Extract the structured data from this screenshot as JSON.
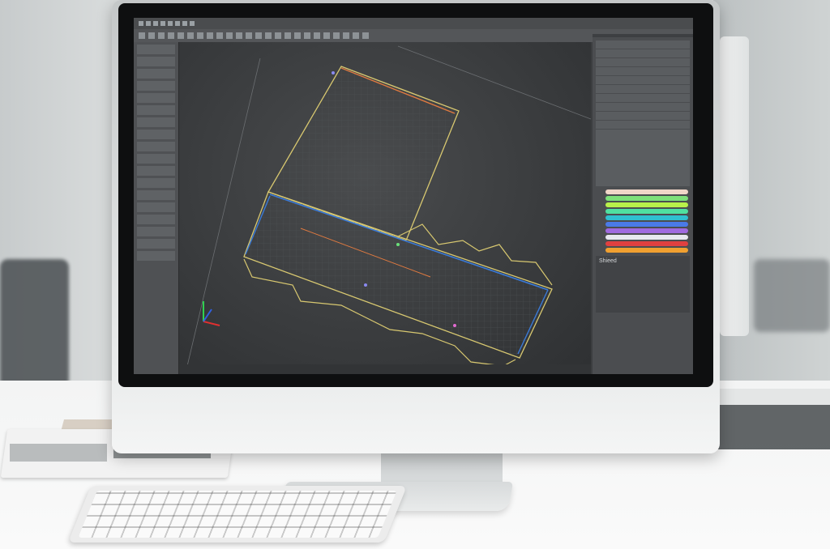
{
  "scene": {
    "description_visible_text": "",
    "app": {
      "title": "",
      "left_panel_rows": [
        "",
        "",
        "",
        "",
        "",
        "",
        "",
        "",
        "",
        "",
        "",
        "",
        "",
        "",
        "",
        "",
        "",
        "",
        "",
        ""
      ],
      "right_panel": {
        "tab_label": "",
        "list_rows": [
          "",
          "",
          "",
          "",
          "",
          "",
          "",
          "",
          "",
          "",
          "",
          "",
          "",
          "",
          ""
        ],
        "section_label": "Shieed",
        "swatches": [
          "#f0d6c8",
          "#7ee07a",
          "#b8f04a",
          "#4fe0a0",
          "#2fc0d0",
          "#4a7ae8",
          "#a06ae0",
          "#e8e8f0",
          "#e04040",
          "#f0a030"
        ]
      },
      "status_text": ""
    },
    "colors": {
      "screen_bg": "#3c3e40",
      "dieline_yellow": "#d8c870",
      "dieline_blue": "#3a7ad8",
      "dieline_orange": "#e07a40",
      "grid": "#505356"
    }
  }
}
